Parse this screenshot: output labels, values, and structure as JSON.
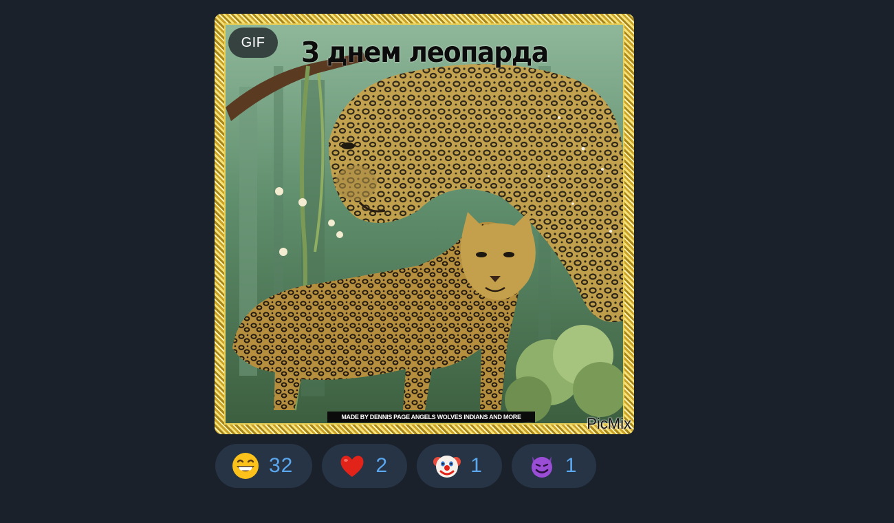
{
  "message": {
    "gif_badge": "GIF",
    "gif_title": "З днем леопарда",
    "gif_credit": "MADE BY DENNIS PAGE ANGELS WOLVES INDIANS AND MORE",
    "gif_watermark": "PicMix"
  },
  "reactions": [
    {
      "emoji": "grinning-face-icon",
      "count": "32"
    },
    {
      "emoji": "red-heart-icon",
      "count": "2"
    },
    {
      "emoji": "clown-face-icon",
      "count": "1"
    },
    {
      "emoji": "smiling-devil-icon",
      "count": "1"
    }
  ],
  "colors": {
    "background": "#1a212b",
    "reaction_pill": "#263446",
    "reaction_count": "#5aa7ee",
    "gif_frame_gold": "#e9cf55"
  }
}
